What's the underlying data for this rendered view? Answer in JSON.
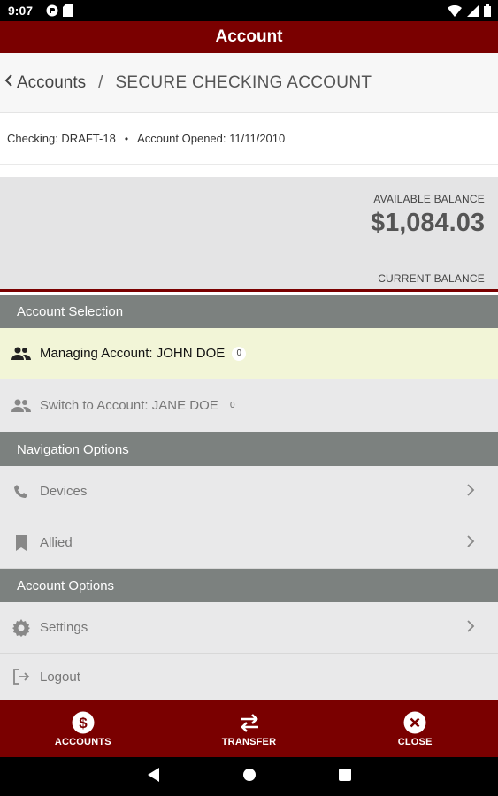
{
  "status_bar": {
    "time": "9:07",
    "left_icons": [
      "google-play-protect-icon",
      "sd-card-icon"
    ],
    "right_icons": [
      "wifi-icon",
      "signal-icon",
      "battery-icon"
    ]
  },
  "header": {
    "title": "Account"
  },
  "breadcrumb": {
    "back_label": "Accounts",
    "separator": "/",
    "current": "SECURE CHECKING ACCOUNT"
  },
  "account_meta": {
    "checking": "Checking: DRAFT-18",
    "dot": "•",
    "opened": "Account Opened: 11/11/2010"
  },
  "balance": {
    "available_label": "AVAILABLE BALANCE",
    "available_amount": "$1,084.03",
    "current_label": "CURRENT BALANCE"
  },
  "sections": {
    "account_selection": "Account Selection",
    "navigation_options": "Navigation Options",
    "account_options": "Account Options"
  },
  "account_selection": [
    {
      "label": "Managing Account: JOHN DOE",
      "count": "0",
      "icon": "people-icon",
      "active": true
    },
    {
      "label": "Switch to Account: JANE DOE",
      "count": "0",
      "icon": "people-icon",
      "active": false
    }
  ],
  "navigation_options": [
    {
      "label": "Devices",
      "icon": "phone-icon"
    },
    {
      "label": "Allied",
      "icon": "bookmark-icon"
    }
  ],
  "account_options": [
    {
      "label": "Settings",
      "icon": "gear-icon"
    },
    {
      "label": "Logout",
      "icon": "logout-icon"
    }
  ],
  "bottom_nav": [
    {
      "label": "ACCOUNTS",
      "icon": "dollar-circle-icon"
    },
    {
      "label": "TRANSFER",
      "icon": "transfer-arrows-icon"
    },
    {
      "label": "CLOSE",
      "icon": "close-circle-icon"
    }
  ],
  "colors": {
    "brand": "#7a0000",
    "section_header": "#7c817f",
    "active_row": "#f2f5d7",
    "row_bg": "#e9e9ea"
  }
}
